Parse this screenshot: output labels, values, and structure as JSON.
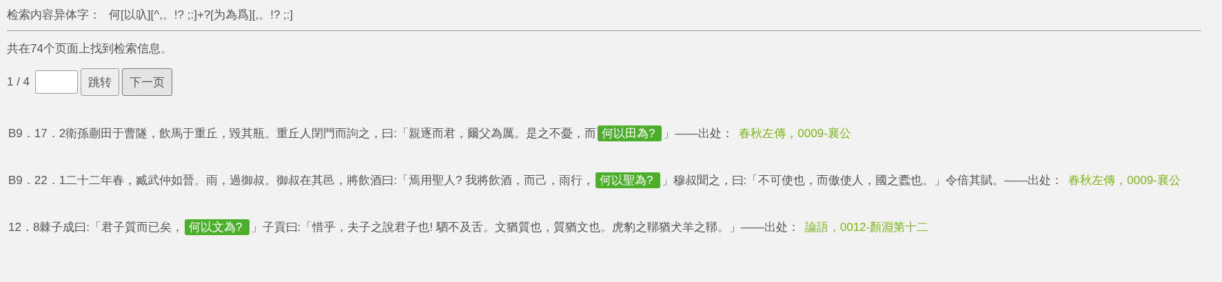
{
  "query": {
    "label": "检索内容异体字：",
    "pattern": "何[以叺][^,。!? ;:]+?[为為爲][,。!? ;:]"
  },
  "summary": "共在74个页面上找到检索信息。",
  "pager": {
    "position": "1 / 4",
    "jump_button": "跳转",
    "next_button": "下一页"
  },
  "results": [
    {
      "before": "B9．17．2衛孫蒯田于曹隧，飲馬于重丘，毀其瓶。重丘人閉門而訽之，曰:「親逐而君，爾父為厲。是之不憂，而",
      "match": "何以田為?",
      "after": "」",
      "source_label": "——出处：",
      "source": "春秋左傳，0009-襄公"
    },
    {
      "before": "B9．22．1二十二年春，臧武仲如晉。雨，過御叔。御叔在其邑，將飲酒曰:「焉用聖人? 我將飲酒，而己，雨行，",
      "match": "何以聖為?",
      "after": "」穆叔聞之，曰:「不可使也，而傲使人，國之蠹也。」令倍其賦。",
      "source_label": "——出处：",
      "source": "春秋左傳，0009-襄公"
    },
    {
      "before": "12．8棘子成曰:「君子質而已矣，",
      "match": "何以文為?",
      "after": "」子貢曰:「惜乎，夫子之說君子也! 駟不及舌。文猶質也，質猶文也。虎豹之鞹猶犬羊之鞹。」",
      "source_label": "——出处：",
      "source": "論語，0012-顏淵第十二"
    }
  ]
}
